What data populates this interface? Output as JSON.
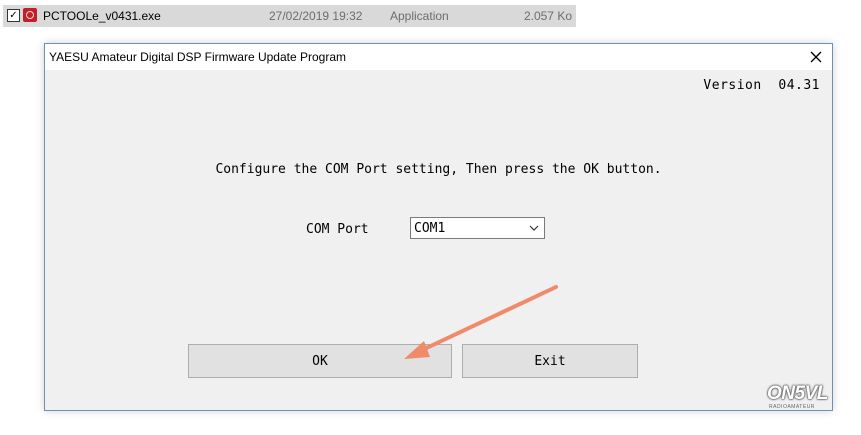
{
  "file_row": {
    "checked": true,
    "name": "PCTOOLe_v0431.exe",
    "date": "27/02/2019 19:32",
    "type": "Application",
    "size": "2.057 Ko"
  },
  "dialog": {
    "title": "YAESU Amateur Digital DSP Firmware Update Program",
    "version": "Version  04.31",
    "instruction": "Configure the COM Port setting, Then press the OK button.",
    "com_port_label": "COM Port",
    "com_port_value": "COM1",
    "ok_label": "OK",
    "exit_label": "Exit"
  },
  "watermark": {
    "text": "ON5VL",
    "subtitle": "RADIOAMATEUR"
  },
  "colors": {
    "arrow": "#ef8a6a",
    "window_border": "#6f8fb3",
    "button_face": "#e1e1e1",
    "file_icon": "#c0202a"
  },
  "icons": [
    "checkbox-icon",
    "app-file-icon",
    "close-icon",
    "chevron-down-icon",
    "annotation-arrow"
  ]
}
